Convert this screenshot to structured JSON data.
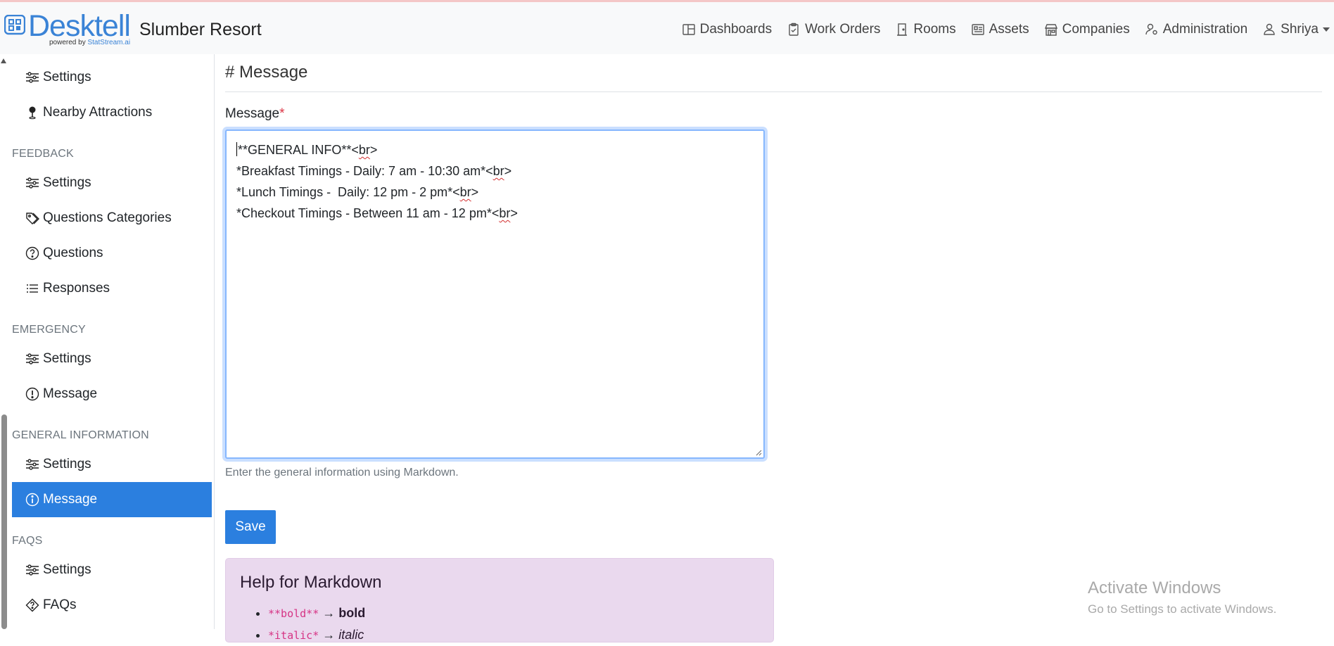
{
  "brand": {
    "name": "Desktell",
    "powered_prefix": "powered by ",
    "powered_name": "StatStream.ai"
  },
  "app_title": "Slumber Resort",
  "nav": {
    "items": [
      {
        "label": "Dashboards",
        "icon": "dashboard-icon"
      },
      {
        "label": "Work Orders",
        "icon": "clipboard-icon"
      },
      {
        "label": "Rooms",
        "icon": "door-icon"
      },
      {
        "label": "Assets",
        "icon": "assets-icon"
      },
      {
        "label": "Companies",
        "icon": "building-icon"
      },
      {
        "label": "Administration",
        "icon": "user-gear-icon"
      }
    ],
    "user": "Shriya"
  },
  "sidebar": {
    "top_items": [
      {
        "label": "Settings",
        "icon": "sliders-icon"
      },
      {
        "label": "Nearby Attractions",
        "icon": "pin-icon"
      }
    ],
    "sections": [
      {
        "title": "FEEDBACK",
        "items": [
          {
            "label": "Settings",
            "icon": "sliders-icon"
          },
          {
            "label": "Questions Categories",
            "icon": "tags-icon"
          },
          {
            "label": "Questions",
            "icon": "question-icon"
          },
          {
            "label": "Responses",
            "icon": "list-icon"
          }
        ]
      },
      {
        "title": "EMERGENCY",
        "items": [
          {
            "label": "Settings",
            "icon": "sliders-icon"
          },
          {
            "label": "Message",
            "icon": "exclamation-icon"
          }
        ]
      },
      {
        "title": "GENERAL INFORMATION",
        "items": [
          {
            "label": "Settings",
            "icon": "sliders-icon"
          },
          {
            "label": "Message",
            "icon": "info-icon",
            "active": true
          }
        ]
      },
      {
        "title": "FAQs",
        "items": [
          {
            "label": "Settings",
            "icon": "sliders-icon"
          },
          {
            "label": "FAQs",
            "icon": "diamond-question-icon"
          }
        ]
      }
    ]
  },
  "main": {
    "title": "# Message",
    "field_label": "Message",
    "required_mark": "*",
    "textarea_lines": [
      "**GENERAL INFO**<br>",
      "*Breakfast Timings - Daily: 7 am - 10:30 am*<br>",
      "*Lunch Timings -  Daily: 12 pm - 2 pm*<br>",
      "*Checkout Timings - Between 11 am - 12 pm*<br>"
    ],
    "help_text": "Enter the general information using Markdown.",
    "save_label": "Save",
    "markdown_help": {
      "title": "Help for Markdown",
      "items": [
        {
          "code": "**bold**",
          "arrow": "→",
          "result": "bold"
        },
        {
          "code": "*italic*",
          "arrow": "→",
          "result": "italic"
        }
      ]
    }
  },
  "watermark": {
    "title": "Activate Windows",
    "subtitle": "Go to Settings to activate Windows."
  },
  "colors": {
    "primary": "#2b7fdf",
    "brand": "#3a83d6",
    "help_bg": "#ead9ee",
    "required": "#dc3545"
  }
}
